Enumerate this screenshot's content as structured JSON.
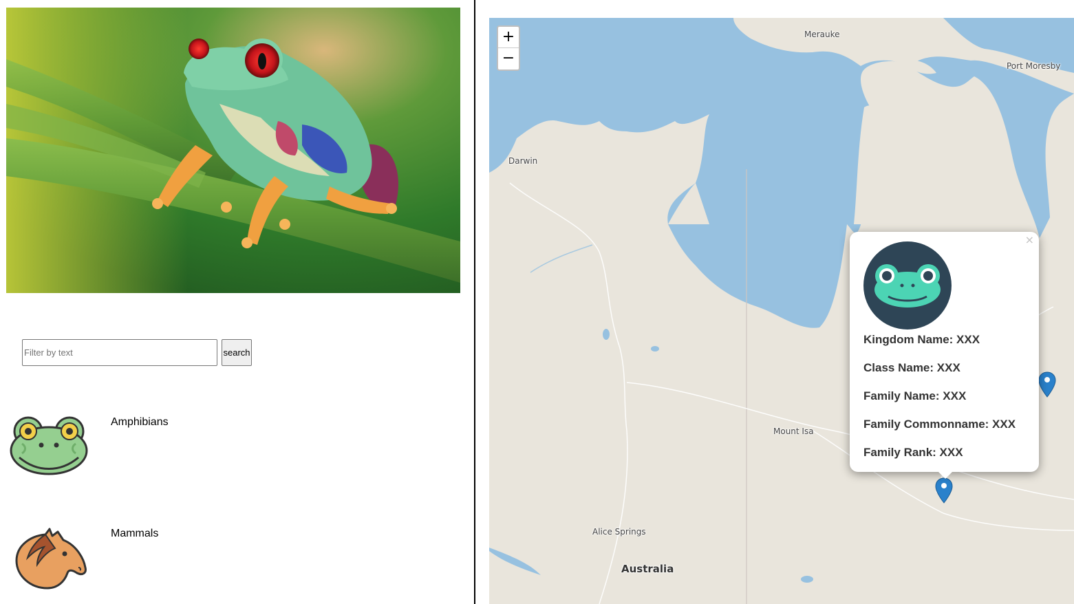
{
  "search": {
    "placeholder": "Filter by text",
    "value": "",
    "button_label": "search"
  },
  "categories": [
    {
      "label": "Amphibians",
      "icon": "frog-icon"
    },
    {
      "label": "Mammals",
      "icon": "horse-icon"
    }
  ],
  "map": {
    "zoom_in_label": "+",
    "zoom_out_label": "−",
    "places": {
      "merauke": "Merauke",
      "port_moresby": "Port Moresby",
      "darwin": "Darwin",
      "mount_isa": "Mount Isa",
      "alice_springs": "Alice Springs",
      "australia": "Australia"
    },
    "colors": {
      "water": "#97c1e0",
      "land": "#e9e5dc",
      "marker": "#2a81cb"
    },
    "popup": {
      "close_label": "×",
      "fields": [
        "Kingdom Name: XXX",
        "Class Name: XXX",
        "Family Name: XXX",
        "Family Commonname: XXX",
        "Family Rank: XXX"
      ]
    }
  }
}
